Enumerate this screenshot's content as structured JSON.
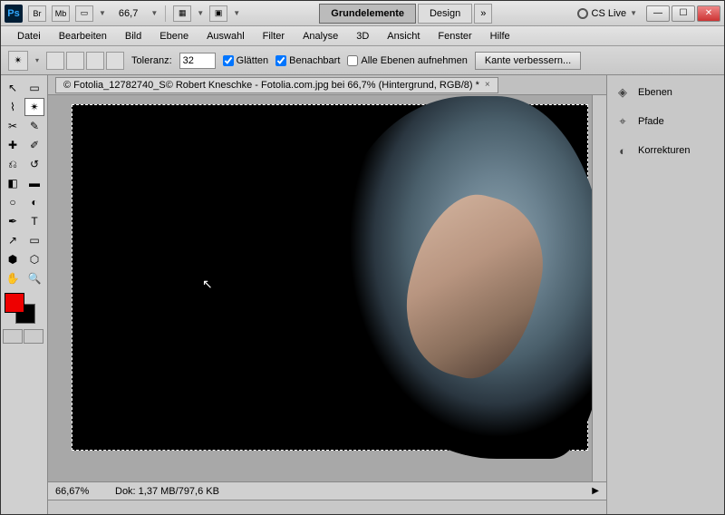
{
  "titlebar": {
    "br": "Br",
    "mb": "Mb",
    "zoom": "66,7",
    "workspace_active": "Grundelemente",
    "workspace_design": "Design",
    "more": "»",
    "cslive": "CS Live"
  },
  "menu": {
    "datei": "Datei",
    "bearbeiten": "Bearbeiten",
    "bild": "Bild",
    "ebene": "Ebene",
    "auswahl": "Auswahl",
    "filter": "Filter",
    "analyse": "Analyse",
    "dreid": "3D",
    "ansicht": "Ansicht",
    "fenster": "Fenster",
    "hilfe": "Hilfe"
  },
  "options": {
    "toleranz_label": "Toleranz:",
    "toleranz_value": "32",
    "glaetten": "Glätten",
    "benachbart": "Benachbart",
    "alle_ebenen": "Alle Ebenen aufnehmen",
    "kante": "Kante verbessern..."
  },
  "document": {
    "tab": "© Fotolia_12782740_S© Robert Kneschke - Fotolia.com.jpg bei 66,7% (Hintergrund, RGB/8) *"
  },
  "status": {
    "zoom": "66,67%",
    "dok": "Dok: 1,37 MB/797,6 KB"
  },
  "panels": {
    "ebenen": "Ebenen",
    "pfade": "Pfade",
    "korrekturen": "Korrekturen"
  },
  "swatch": {
    "fg": "#ee0000",
    "bg": "#000000"
  }
}
